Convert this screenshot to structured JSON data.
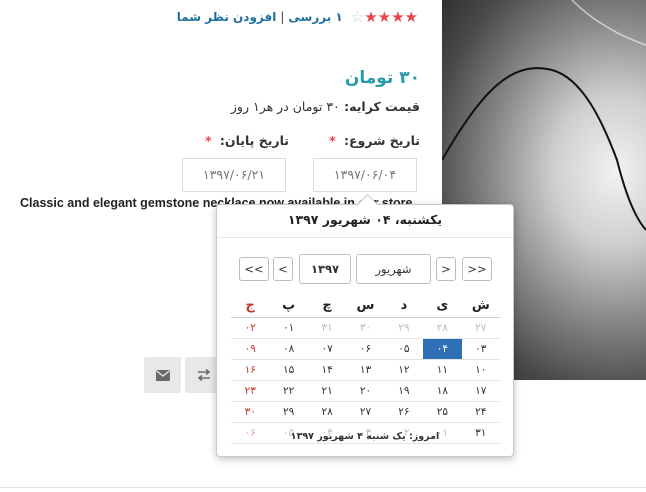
{
  "rating": {
    "stars": 4,
    "max": 5,
    "reviews_text": "۱ بررسی",
    "separator": "|",
    "add_review": "افزودن نظر شما"
  },
  "price": {
    "text": "۳۰ تومان"
  },
  "rent": {
    "label": "قیمت کرایه:",
    "value": "۳۰ تومان در هر۱ روز"
  },
  "form": {
    "start_label": "تاریخ شروع:",
    "end_label": "تاریخ پایان:",
    "required_mark": "*",
    "start_value": "۱۳۹۷/۰۶/۰۴",
    "end_value": "۱۳۹۷/۰۶/۲۱"
  },
  "description": "Classic and elegant gemstone necklace now available in our store",
  "actions": {
    "mail_icon": "envelope-icon",
    "compare_icon": "compare-arrows-icon"
  },
  "colors": {
    "accent": "#2a9aa8",
    "star": "#e9454f",
    "link": "#1d6f9e",
    "selected": "#2f6fb5"
  },
  "datepicker": {
    "header": "یکشنبه، ۰۴ شهریور ۱۳۹۷",
    "nav": {
      "next_year": ">>",
      "next_month": ">",
      "month": "شهریور",
      "year": "۱۳۹۷",
      "prev_month": "<",
      "prev_year": "<<"
    },
    "weekdays": [
      "ش",
      "ی",
      "د",
      "س",
      "چ",
      "پ",
      "ج"
    ],
    "weeks": [
      [
        "۲۷",
        "۲۸",
        "۲۹",
        "۳۰",
        "۳۱",
        "۰۱",
        "۰۲"
      ],
      [
        "۰۳",
        "۰۴",
        "۰۵",
        "۰۶",
        "۰۷",
        "۰۸",
        "۰۹"
      ],
      [
        "۱۰",
        "۱۱",
        "۱۲",
        "۱۳",
        "۱۴",
        "۱۵",
        "۱۶"
      ],
      [
        "۱۷",
        "۱۸",
        "۱۹",
        "۲۰",
        "۲۱",
        "۲۲",
        "۲۳"
      ],
      [
        "۲۴",
        "۲۵",
        "۲۶",
        "۲۷",
        "۲۸",
        "۲۹",
        "۳۰"
      ],
      [
        "۳۱",
        "۰۱",
        "۰۲",
        "۰۳",
        "۰۴",
        "۰۵",
        "۰۶"
      ]
    ],
    "other_month": [
      [
        true,
        true,
        true,
        true,
        true,
        false,
        false
      ],
      [
        false,
        false,
        false,
        false,
        false,
        false,
        false
      ],
      [
        false,
        false,
        false,
        false,
        false,
        false,
        false
      ],
      [
        false,
        false,
        false,
        false,
        false,
        false,
        false
      ],
      [
        false,
        false,
        false,
        false,
        false,
        false,
        false
      ],
      [
        false,
        true,
        true,
        true,
        true,
        true,
        true
      ]
    ],
    "selected": [
      1,
      1
    ],
    "footer": "امروز: یک شنبه ۴ شهریور ۱۳۹۷"
  }
}
